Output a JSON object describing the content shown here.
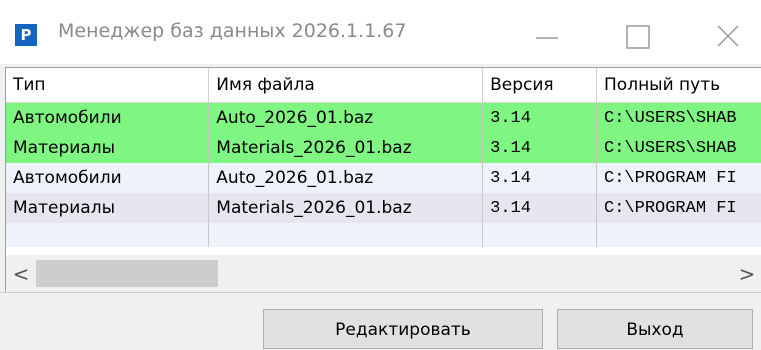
{
  "window": {
    "title": "Менеджер баз данных 2026.1.1.67",
    "icon_letter": "P",
    "icon_color": "#1565c0",
    "controls": [
      "minimize-icon",
      "maximize-icon",
      "close-icon"
    ]
  },
  "table": {
    "columns": [
      "Тип",
      "Имя файла",
      "Версия",
      "Полный путь"
    ],
    "rows": [
      {
        "type": "Автомобили",
        "file": "Auto_2026_01.baz",
        "version": "3.14",
        "path": "C:\\USERS\\SHAB",
        "highlight": "#7ff582"
      },
      {
        "type": "Материалы",
        "file": "Materials_2026_01.baz",
        "version": "3.14",
        "path": "C:\\USERS\\SHAB",
        "highlight": "#7ff582"
      },
      {
        "type": "Автомобили",
        "file": "Auto_2026_01.baz",
        "version": "3.14",
        "path": "C:\\PROGRAM FI",
        "highlight": "#eef3fb"
      },
      {
        "type": "Материалы",
        "file": "Materials_2026_01.baz",
        "version": "3.14",
        "path": "C:\\PROGRAM FI",
        "highlight": "#e6e6f0"
      }
    ]
  },
  "buttons": {
    "edit": "Редактировать",
    "exit": "Выход"
  },
  "scrollbar": {
    "left_arrow": "<",
    "right_arrow": ">"
  }
}
